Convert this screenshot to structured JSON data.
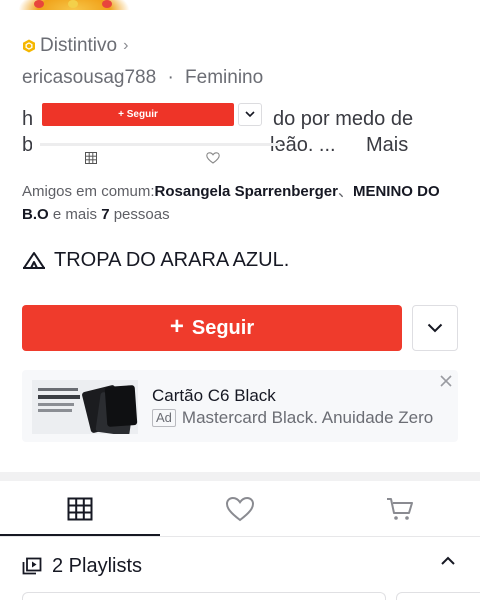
{
  "profile": {
    "badge_label": "Distintivo",
    "handle": "ericasousag788",
    "separator": "·",
    "gender": "Feminino",
    "bio_line1_left": "h",
    "bio_line1_right": "do por medo de",
    "bio_line2_left": "b",
    "bio_line2_right": "leão. ...",
    "bio_more": "Mais",
    "mutual_label": "Amigos em comum:",
    "mutual_friend1": "Rosangela Sparrenberger",
    "mutual_sep": "、",
    "mutual_friend2": "MENINO DO B.O",
    "mutual_and_more": "e mais",
    "mutual_count": "7",
    "mutual_people": "pessoas",
    "group_name": "TROPA DO ARARA AZUL."
  },
  "floating_bar": {
    "follow_label": "+ Seguir"
  },
  "actions": {
    "follow_plus": "+",
    "follow_label": "Seguir"
  },
  "ad": {
    "title": "Cartão C6 Black",
    "badge": "Ad",
    "subtitle": "Mastercard Black. Anuidade Zero"
  },
  "tabs": [
    {
      "icon": "grid-icon"
    },
    {
      "icon": "heart-icon"
    },
    {
      "icon": "cart-icon"
    }
  ],
  "playlists": {
    "label": "2 Playlists"
  },
  "colors": {
    "accent": "#ef3b2c",
    "text": "#161823",
    "muted": "#6b6d74"
  }
}
